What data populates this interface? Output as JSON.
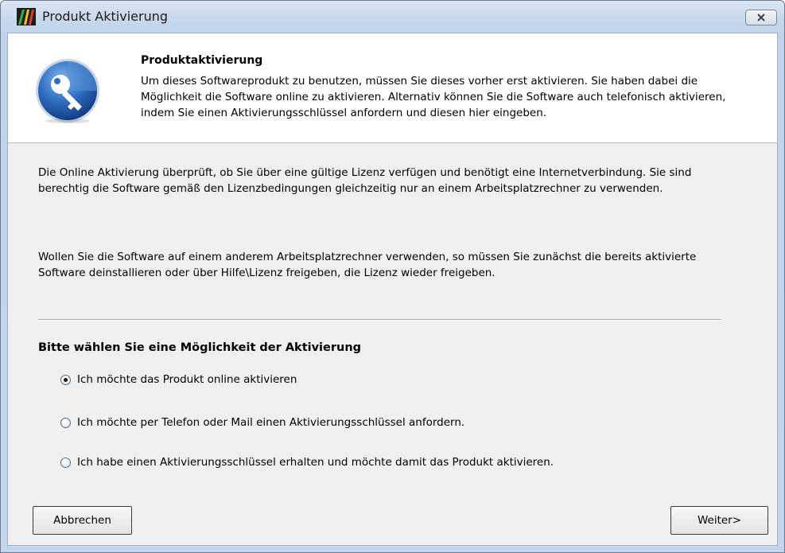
{
  "window": {
    "title": "Produkt Aktivierung"
  },
  "header": {
    "title": "Produktaktivierung",
    "description": "Um dieses Softwareprodukt zu benutzen, müssen Sie dieses vorher erst aktivieren. Sie haben dabei die Möglichkeit die Software online zu aktivieren. Alternativ können Sie die Software auch telefonisch aktivieren, indem Sie einen Aktivierungsschlüssel anfordern und diesen hier eingeben."
  },
  "body": {
    "paragraph1": "Die Online Aktivierung überprüft, ob Sie über eine gültige Lizenz verfügen und benötigt eine Internetverbindung. Sie sind berechtig die Software gemäß den Lizenzbedingungen gleichzeitig nur an einem Arbeitsplatzrechner zu verwenden.",
    "paragraph2": "Wollen Sie die Software auf einem anderem Arbeitsplatzrechner verwenden, so müssen Sie zunächst die bereits aktivierte Software deinstallieren oder über Hilfe\\Lizenz freigeben, die Lizenz wieder freigeben."
  },
  "options": {
    "title": "Bitte wählen Sie eine Möglichkeit der Aktivierung",
    "items": [
      {
        "label": "Ich möchte das Produkt online aktivieren",
        "selected": true
      },
      {
        "label": "Ich möchte per Telefon oder Mail einen Aktivierungsschlüssel anfordern.",
        "selected": false
      },
      {
        "label": "Ich habe einen Aktivierungsschlüssel erhalten und möchte damit das Produkt aktivieren.",
        "selected": false
      }
    ]
  },
  "buttons": {
    "cancel": "Abbrechen",
    "next": "Weiter>"
  },
  "icons": {
    "app": "app-logo-icon",
    "header": "key-icon",
    "close": "close-icon"
  }
}
